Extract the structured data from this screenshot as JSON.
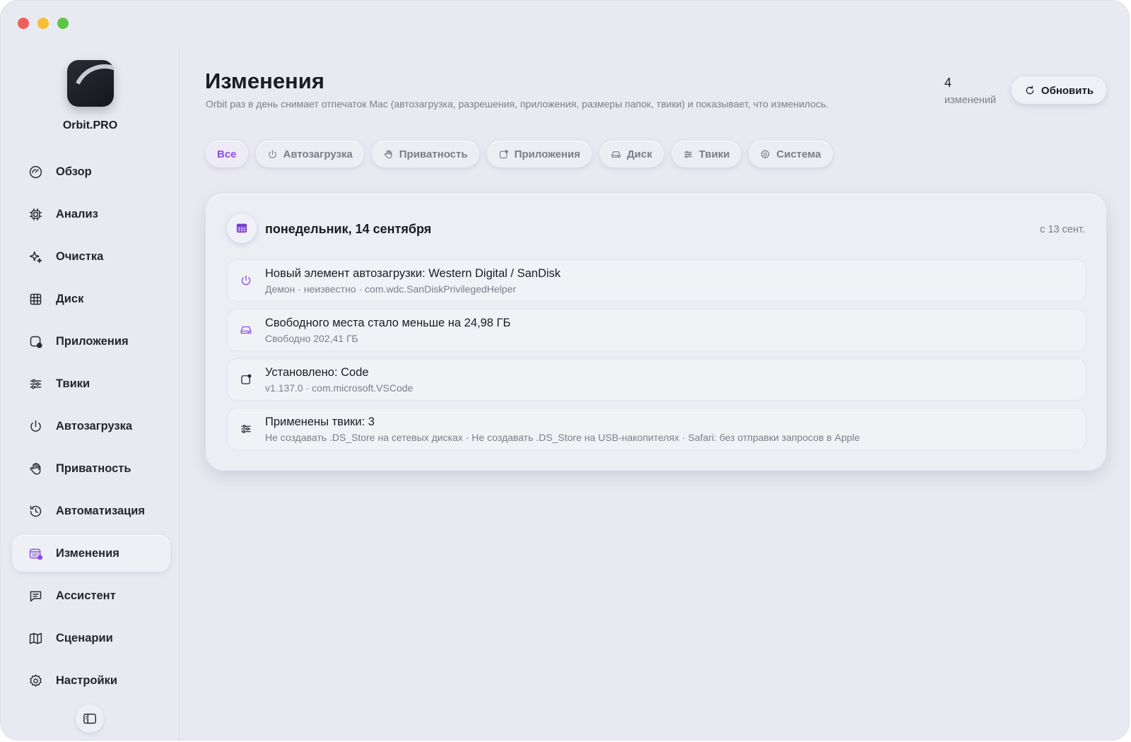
{
  "app": {
    "name": "Orbit.PRO"
  },
  "sidebar": {
    "items": [
      {
        "label": "Обзор",
        "icon": "gauge-icon"
      },
      {
        "label": "Анализ",
        "icon": "cpu-icon"
      },
      {
        "label": "Очистка",
        "icon": "sparkle-icon"
      },
      {
        "label": "Диск",
        "icon": "grid-icon"
      },
      {
        "label": "Приложения",
        "icon": "apps-icon"
      },
      {
        "label": "Твики",
        "icon": "sliders-icon"
      },
      {
        "label": "Автозагрузка",
        "icon": "power-icon"
      },
      {
        "label": "Приватность",
        "icon": "hand-icon"
      },
      {
        "label": "Автоматизация",
        "icon": "history-icon"
      },
      {
        "label": "Изменения",
        "icon": "calendar-icon",
        "active": true
      },
      {
        "label": "Ассистент",
        "icon": "chat-icon"
      },
      {
        "label": "Сценарии",
        "icon": "map-icon"
      },
      {
        "label": "Настройки",
        "icon": "gear-icon"
      }
    ]
  },
  "header": {
    "title": "Изменения",
    "subtitle": "Orbit раз в день снимает отпечаток Mac (автозагрузка, разрешения, приложения, размеры папок, твики) и показывает, что изменилось.",
    "count_value": "4",
    "count_label": "изменений",
    "refresh_label": "Обновить"
  },
  "filters": [
    {
      "label": "Все",
      "active": true
    },
    {
      "label": "Автозагрузка",
      "icon": "power-icon"
    },
    {
      "label": "Приватность",
      "icon": "hand-icon"
    },
    {
      "label": "Приложения",
      "icon": "apps-icon"
    },
    {
      "label": "Диск",
      "icon": "drive-icon"
    },
    {
      "label": "Твики",
      "icon": "sliders-icon"
    },
    {
      "label": "Система",
      "icon": "gear-icon"
    }
  ],
  "day": {
    "title": "понедельник, 14 сентября",
    "since": "с 13 сент.",
    "changes": [
      {
        "title": "Новый элемент автозагрузки: Western Digital / SanDisk",
        "subtitle": "Демон · неизвестно · com.wdc.SanDiskPrivilegedHelper",
        "icon": "power-icon",
        "icon_color": "#8a4fe0"
      },
      {
        "title": "Свободного места стало меньше на 24,98 ГБ",
        "subtitle": "Свободно 202,41 ГБ",
        "icon": "drive-icon",
        "icon_color": "#8a4fe0"
      },
      {
        "title": "Установлено: Code",
        "subtitle": "v1.137.0 · com.microsoft.VSCode",
        "icon": "apps-icon",
        "icon_color": "#2a2b33"
      },
      {
        "title": "Применены твики: 3",
        "subtitle": "Не создавать .DS_Store на сетевых дисках · Не создавать .DS_Store на USB-накопителях · Safari: без отправки запросов в Apple",
        "icon": "sliders-icon",
        "icon_color": "#2a2b33"
      }
    ]
  },
  "colors": {
    "accent": "#8a4fe0",
    "background": "#e9eaf1",
    "muted_text": "#7c7d8a"
  }
}
